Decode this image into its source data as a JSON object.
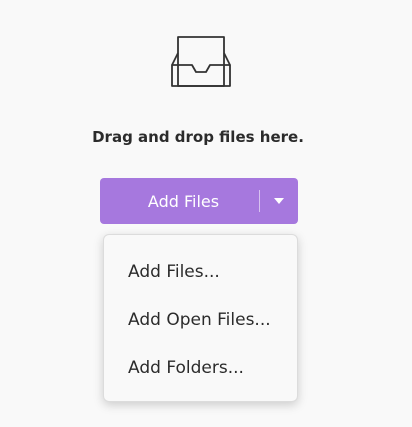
{
  "dropzone": {
    "icon": "inbox-tray-icon",
    "prompt": "Drag and drop files here."
  },
  "add_button": {
    "label": "Add Files",
    "arrow_icon": "caret-down-icon",
    "color": "#a678de"
  },
  "menu": {
    "items": [
      {
        "label": "Add Files..."
      },
      {
        "label": "Add Open Files..."
      },
      {
        "label": "Add Folders..."
      }
    ]
  }
}
